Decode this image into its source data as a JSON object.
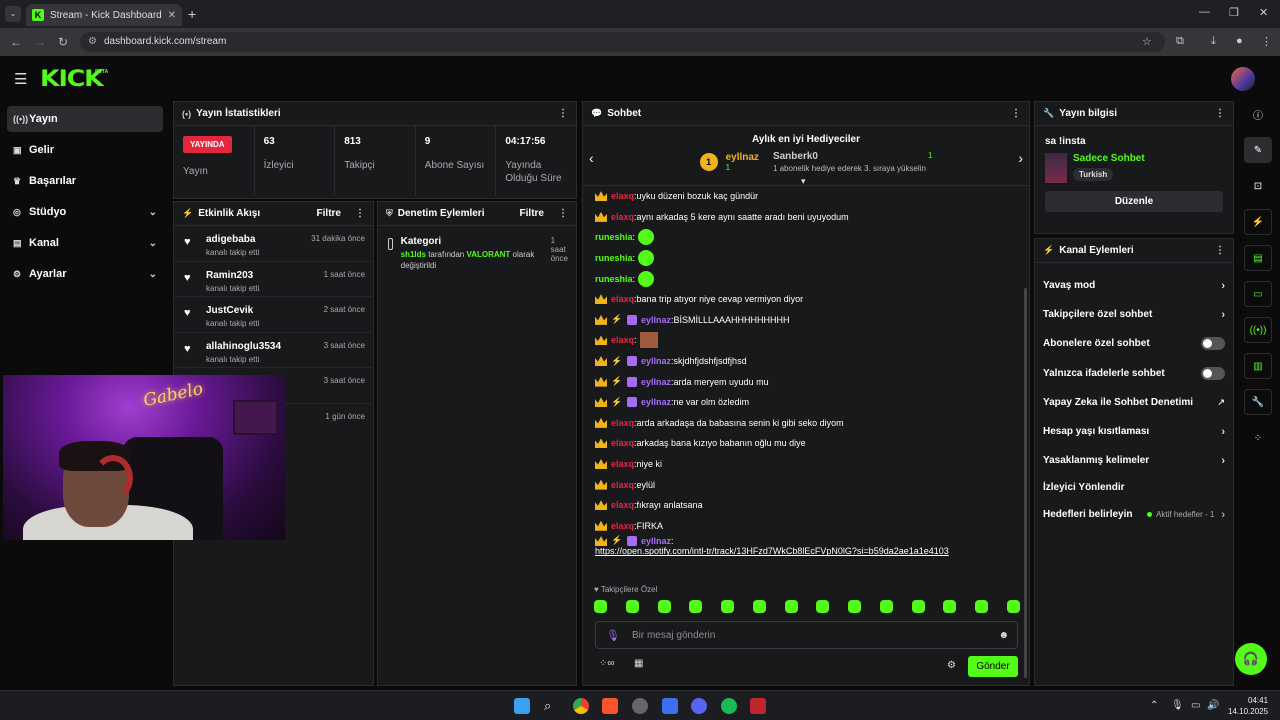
{
  "browser": {
    "tab_title": "Stream - Kick Dashboard",
    "url": "dashboard.kick.com/stream"
  },
  "brand": {
    "logo": "KICK",
    "beta": "BETA",
    "accent": "#53fc18"
  },
  "sidebar": {
    "items": [
      {
        "label": "Yayın",
        "icon": "broadcast-icon"
      },
      {
        "label": "Gelir",
        "icon": "wallet-icon"
      },
      {
        "label": "Başarılar",
        "icon": "trophy-icon"
      },
      {
        "label": "Stüdyo",
        "icon": "studio-icon"
      },
      {
        "label": "Kanal",
        "icon": "channel-icon"
      },
      {
        "label": "Ayarlar",
        "icon": "gear-icon"
      }
    ]
  },
  "stats": {
    "title": "Yayın İstatistikleri",
    "live": "YAYINDA",
    "live_label": "Yayın",
    "items": [
      {
        "value": "63",
        "label": "İzleyici"
      },
      {
        "value": "813",
        "label": "Takipçi"
      },
      {
        "value": "9",
        "label": "Abone Sayısı"
      },
      {
        "value": "04:17:56",
        "label": "Yayında Olduğu Süre"
      }
    ]
  },
  "activity": {
    "title": "Etkinlik Akışı",
    "filter": "Filtre",
    "items": [
      {
        "name": "adigebaba",
        "action": "kanalı takip etti",
        "time": "31 dakika önce"
      },
      {
        "name": "Ramin203",
        "action": "kanalı takip etti",
        "time": "1 saat önce"
      },
      {
        "name": "JustCevik",
        "action": "kanalı takip etti",
        "time": "2 saat önce"
      },
      {
        "name": "allahinoglu3534",
        "action": "kanalı takip etti",
        "time": "3 saat önce"
      },
      {
        "name": "",
        "action": "",
        "time": "3 saat önce"
      },
      {
        "name": "",
        "action": "",
        "time": "1 gün önce"
      }
    ]
  },
  "moderation": {
    "title": "Denetim Eylemleri",
    "filter": "Filtre",
    "item": {
      "title": "Kategori",
      "time": "1 saat önce",
      "user": "sh1lds",
      "pre": " tarafından ",
      "cat": "VALORANT",
      "post": " olarak değiştirildi"
    }
  },
  "webcam": {
    "neon": "Gabelo"
  },
  "chat": {
    "title": "Sohbet",
    "gifters_title": "Aylık en iyi Hediyeciler",
    "top": {
      "rank": "1",
      "name": "eyllnaz",
      "count": "1"
    },
    "second": {
      "name": "Sanberk0",
      "count": "1"
    },
    "promo": "1 abonelik hediye ederek 3. sıraya yükselin",
    "messages": [
      {
        "u": "elaxq",
        "c": "red",
        "t": "uyku düzeni bozuk kaç gündür",
        "badges": "c"
      },
      {
        "u": "elaxq",
        "c": "red",
        "t": "aynı arkadaş 5 kere aynı saatte aradı beni uyuyodum",
        "badges": "c"
      },
      {
        "u": "runeshia",
        "c": "green",
        "t": "",
        "emote": "1",
        "badges": ""
      },
      {
        "u": "runeshia",
        "c": "green",
        "t": "",
        "emote": "1",
        "badges": ""
      },
      {
        "u": "runeshia",
        "c": "green",
        "t": "",
        "emote": "1",
        "badges": ""
      },
      {
        "u": "elaxq",
        "c": "red",
        "t": "bana trip atıyor niye cevap vermiyon diyor",
        "badges": "c"
      },
      {
        "u": "eyllnaz",
        "c": "purple",
        "t": "BİSMİLLLAAAHHHHHHHHH",
        "badges": "cvg"
      },
      {
        "u": "elaxq",
        "c": "red",
        "t": "",
        "emote": "img",
        "badges": "c"
      },
      {
        "u": "eyllnaz",
        "c": "purple",
        "t": "skjdhfjdshfjsdfjhsd",
        "badges": "cvg"
      },
      {
        "u": "eyllnaz",
        "c": "purple",
        "t": "arda meryem uyudu mu",
        "badges": "cvg"
      },
      {
        "u": "eyllnaz",
        "c": "purple",
        "t": "ne var olm özledim",
        "badges": "cvg"
      },
      {
        "u": "elaxq",
        "c": "red",
        "t": "arda arkadaşa da babasına senin ki gibi seko diyom",
        "badges": "c"
      },
      {
        "u": "elaxq",
        "c": "red",
        "t": "arkadaş bana kızıyo babanın oğlu mu diye",
        "badges": "c"
      },
      {
        "u": "elaxq",
        "c": "red",
        "t": "niye ki",
        "badges": "c"
      },
      {
        "u": "elaxq",
        "c": "red",
        "t": "eylül",
        "badges": "c"
      },
      {
        "u": "elaxq",
        "c": "red",
        "t": "fıkrayı anlatsana",
        "badges": "c"
      },
      {
        "u": "elaxq",
        "c": "red",
        "t": "FIRKA",
        "badges": "c"
      },
      {
        "u": "eyllnaz",
        "c": "purple",
        "t": "https://open.spotify.com/intl-tr/track/13HFzd7WkCb8lEcFVpN0lG?si=b59da2ae1a1e4103",
        "link": "1",
        "badges": "cvg"
      }
    ],
    "follow_only": "Takipçilere Özel",
    "placeholder": "Bir mesaj gönderin",
    "send": "Gönder"
  },
  "info": {
    "title": "Yayın bilgisi",
    "stream_title": "sa !insta",
    "category": "Sadece Sohbet",
    "tag": "Turkish",
    "edit": "Düzenle"
  },
  "actions": {
    "title": "Kanal Eylemleri",
    "items": [
      {
        "label": "Yavaş mod",
        "kind": "arrow"
      },
      {
        "label": "Takipçilere özel sohbet",
        "kind": "arrow"
      },
      {
        "label": "Abonelere özel sohbet",
        "kind": "toggle"
      },
      {
        "label": "Yalnızca ifadelerle sohbet",
        "kind": "toggle"
      },
      {
        "label": "Yapay Zeka ile Sohbet Denetimi",
        "kind": "ext"
      },
      {
        "label": "Hesap yaşı kısıtlaması",
        "kind": "arrow"
      },
      {
        "label": "Yasaklanmış kelimeler",
        "kind": "arrow"
      },
      {
        "label": "İzleyici Yönlendir",
        "kind": "none"
      },
      {
        "label": "Hedefleri belirleyin",
        "kind": "goals",
        "extra": "Aktif hedefler - 1"
      }
    ]
  },
  "clock": {
    "time": "04:41",
    "date": "14.10.2025"
  }
}
